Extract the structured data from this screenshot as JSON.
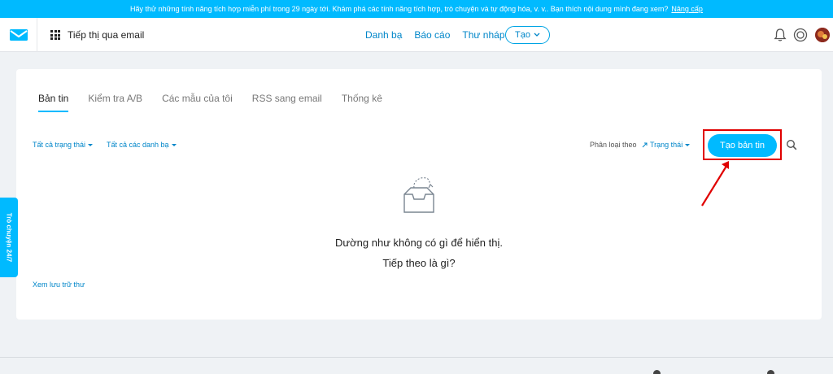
{
  "promo": {
    "text": "Hãy thử những tính năng tích hợp miễn phí trong 29 ngày tới. Khám phá các tính năng tích hợp, trò chuyện và tự động hóa, v. v.. Bạn thích nội dung mình đang xem?",
    "link": "Nâng cấp"
  },
  "topnav": {
    "app_title": "Tiếp thị qua email",
    "links": [
      "Danh bạ",
      "Báo cáo",
      "Thư nháp"
    ],
    "create_label": "Tạo",
    "icons": [
      "bell-icon",
      "help-icon",
      "avatar"
    ]
  },
  "tabs": [
    {
      "label": "Bản tin",
      "active": true
    },
    {
      "label": "Kiểm tra A/B",
      "active": false
    },
    {
      "label": "Các mẫu của tôi",
      "active": false
    },
    {
      "label": "RSS sang email",
      "active": false
    },
    {
      "label": "Thống kê",
      "active": false
    }
  ],
  "filters": {
    "status": "Tất cả trạng thái",
    "lists": "Tất cả các danh bạ",
    "sort_label": "Phân loại theo",
    "sort_value": "Trạng thái"
  },
  "primary_button": "Tạo bản tin",
  "empty_state": {
    "line1": "Dường như không có gì để hiển thị.",
    "line2": "Tiếp theo là gì?"
  },
  "archive_link": "Xem lưu trữ thư",
  "side_chat": "Trò chuyện 24/7",
  "colors": {
    "accent": "#00baff",
    "link": "#0086c9",
    "highlight": "#e00000"
  }
}
